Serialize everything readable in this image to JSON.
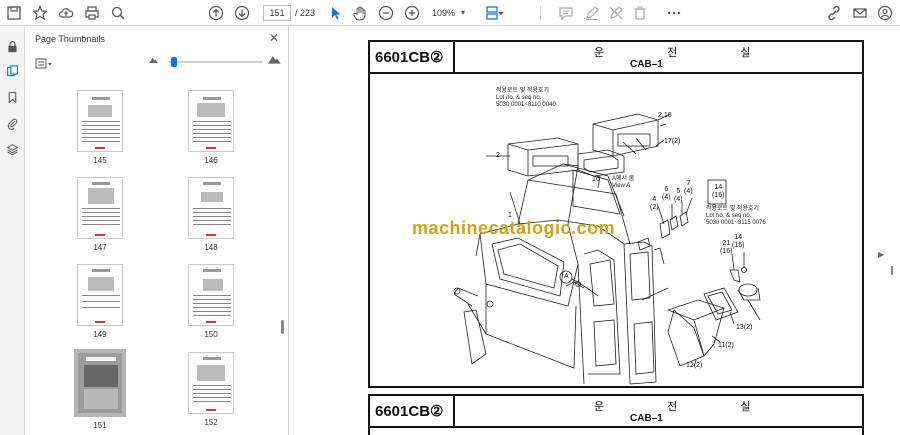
{
  "toolbar": {
    "page_current": "151",
    "page_total": "/ 223",
    "zoom": "109%"
  },
  "panel": {
    "title": "Page Thumbnails",
    "close": "✕"
  },
  "thumbnails": [
    {
      "label": "145"
    },
    {
      "label": "146"
    },
    {
      "label": "147"
    },
    {
      "label": "148"
    },
    {
      "label": "149"
    },
    {
      "label": "150"
    },
    {
      "label": "151"
    },
    {
      "label": "152"
    }
  ],
  "doc": {
    "header_code": "6601CB②",
    "header_korean": "운 전 실",
    "header_english": "CAB–1",
    "header2_code": "6601CB②",
    "header2_korean": "운 전 실",
    "header2_english": "CAB–1",
    "note1": "적용로트 및 적용호기\nLot no. & seq no.\n5030 0001~8110 0040",
    "note2": "적용로트 및 적용호기\nLot no. & seq no.\n5030 0001~8115 0076",
    "view_a": "A에서 봄\nView A",
    "watermark": "machinecatalogic.com",
    "callouts": {
      "c_2_18": "2,18",
      "c_17_2": "17(2)",
      "c_2": "2",
      "c_16": "16",
      "c_14_16": "14\n(16)",
      "c_1": "1",
      "c_6_4": "6\n(4)",
      "c_4_2": "4\n(2)",
      "c_5_4": "5\n(4)",
      "c_7_4": "7\n(4)",
      "c_21_16": "21\n(16)",
      "c_14_16b": "14\n(16)",
      "c_a": "A",
      "c_13_2": "13(2)",
      "c_11_2": "11(2)",
      "c_12_2": "12(2)"
    }
  }
}
